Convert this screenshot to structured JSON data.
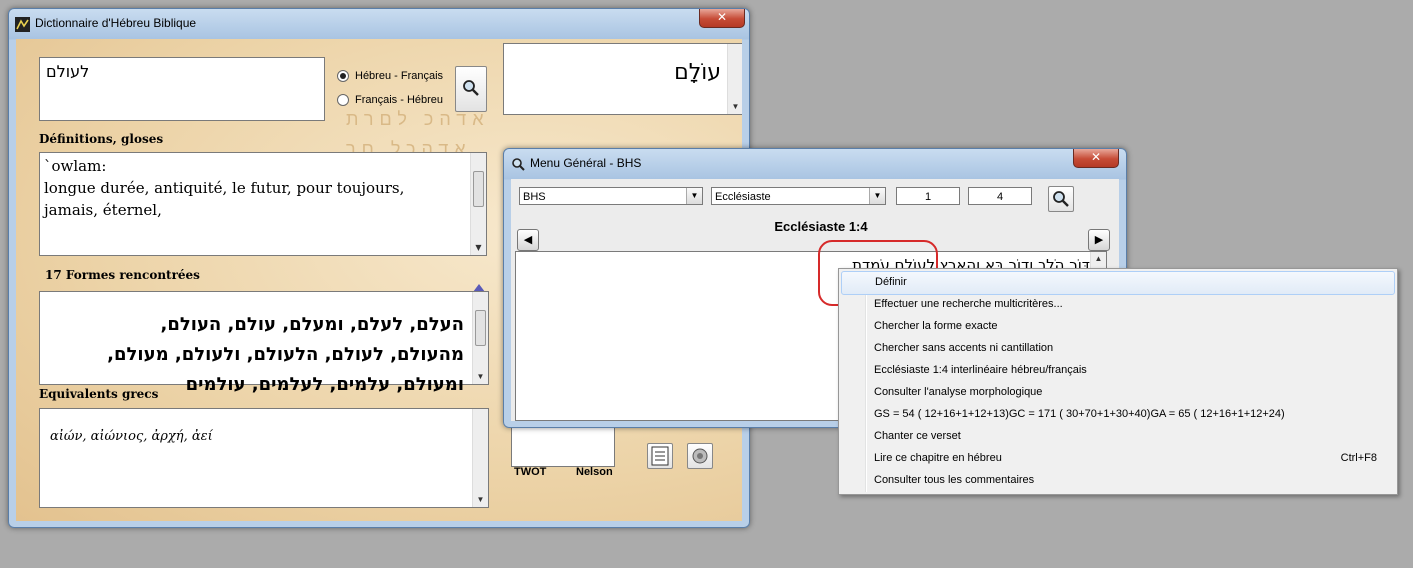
{
  "dict_window": {
    "title": "Dictionnaire d'Hébreu Biblique",
    "close_glyph": "✕",
    "search_input": "לעולם",
    "radio_heb_fr": "Hébreu - Français",
    "radio_fr_heb": "Français - Hébreu",
    "headword": "עוֹלָם",
    "definitions_label": "Définitions, gloses",
    "definitions_line1": "`owlam:",
    "definitions_line2": "longue durée, antiquité, le futur, pour toujours,",
    "definitions_line3": "jamais, éternel,",
    "forms_label": "17 Formes rencontrées",
    "forms_line1": "העלם, לעלם, ומעלם, עולם, העולם,",
    "forms_line2": "מהעולם, לעולם, הלעולם, ולעולם, מעולם,",
    "forms_line3": "ומעולם, עלמים, לעלמים, עולמים",
    "greek_label": "Equivalents grecs",
    "greek_text": "αἰών, αἰώνιος, ἀρχή, ἀεί",
    "twot_label": "TWOT",
    "nelson_label": "Nelson"
  },
  "menu_window": {
    "title": "Menu Général - BHS",
    "close_glyph": "✕",
    "version": "BHS",
    "book": "Ecclésiaste",
    "chapter": "1",
    "verse": "4",
    "reference": "Ecclésiaste 1:4",
    "verse_text": "דּוֹר הֹלֵךְ וְדוֹר בָּא וְהָאָרֶץ לְעוֹלָם עֹמָדֶת"
  },
  "context_menu": {
    "items": [
      {
        "label": "Définir",
        "shortcut": ""
      },
      {
        "label": "Effectuer une recherche multicritères...",
        "shortcut": ""
      },
      {
        "label": "Chercher la forme exacte",
        "shortcut": ""
      },
      {
        "label": "Chercher sans accents ni cantillation",
        "shortcut": ""
      },
      {
        "label": "Ecclésiaste 1:4 interlinéaire hébreu/français",
        "shortcut": ""
      },
      {
        "label": "Consulter l'analyse morphologique",
        "shortcut": ""
      },
      {
        "label": "GS = 54 ( 12+16+1+12+13)GC = 171 ( 30+70+1+30+40)GA = 65 ( 12+16+1+12+24)",
        "shortcut": ""
      },
      {
        "label": "Chanter ce verset",
        "shortcut": ""
      },
      {
        "label": "Lire ce chapitre en hébreu",
        "shortcut": "Ctrl+F8"
      },
      {
        "label": "Consulter tous les commentaires",
        "shortcut": ""
      }
    ]
  },
  "colors": {
    "annotation": "#d62a2a",
    "parchment": "#ecd3a7"
  }
}
